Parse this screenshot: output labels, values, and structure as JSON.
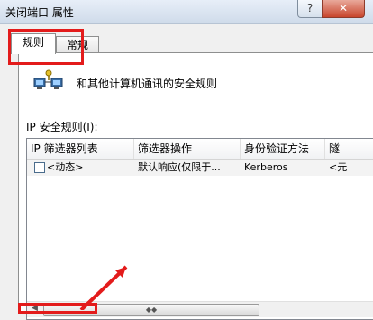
{
  "window": {
    "title": "关闭端口 属性",
    "help_label": "?",
    "close_label": "✕"
  },
  "tabs": [
    {
      "label": "规则"
    },
    {
      "label": "常规"
    }
  ],
  "panel": {
    "description": "和其他计算机通讯的安全规则",
    "list_label": "IP 安全规则(I):"
  },
  "table": {
    "columns": [
      "IP 筛选器列表",
      "筛选器操作",
      "身份验证方法",
      "隧"
    ],
    "rows": [
      {
        "filter_list": "<动态>",
        "action": "默认响应(仅限于...",
        "auth": "Kerberos",
        "tunnel": "<元"
      }
    ]
  },
  "scrollbar": {
    "left_arrow": "◀",
    "right_arrow": "▶",
    "thumb_grip": "◆◆"
  },
  "colors": {
    "highlight": "#e31b1b",
    "close_button": "#c8452c"
  }
}
